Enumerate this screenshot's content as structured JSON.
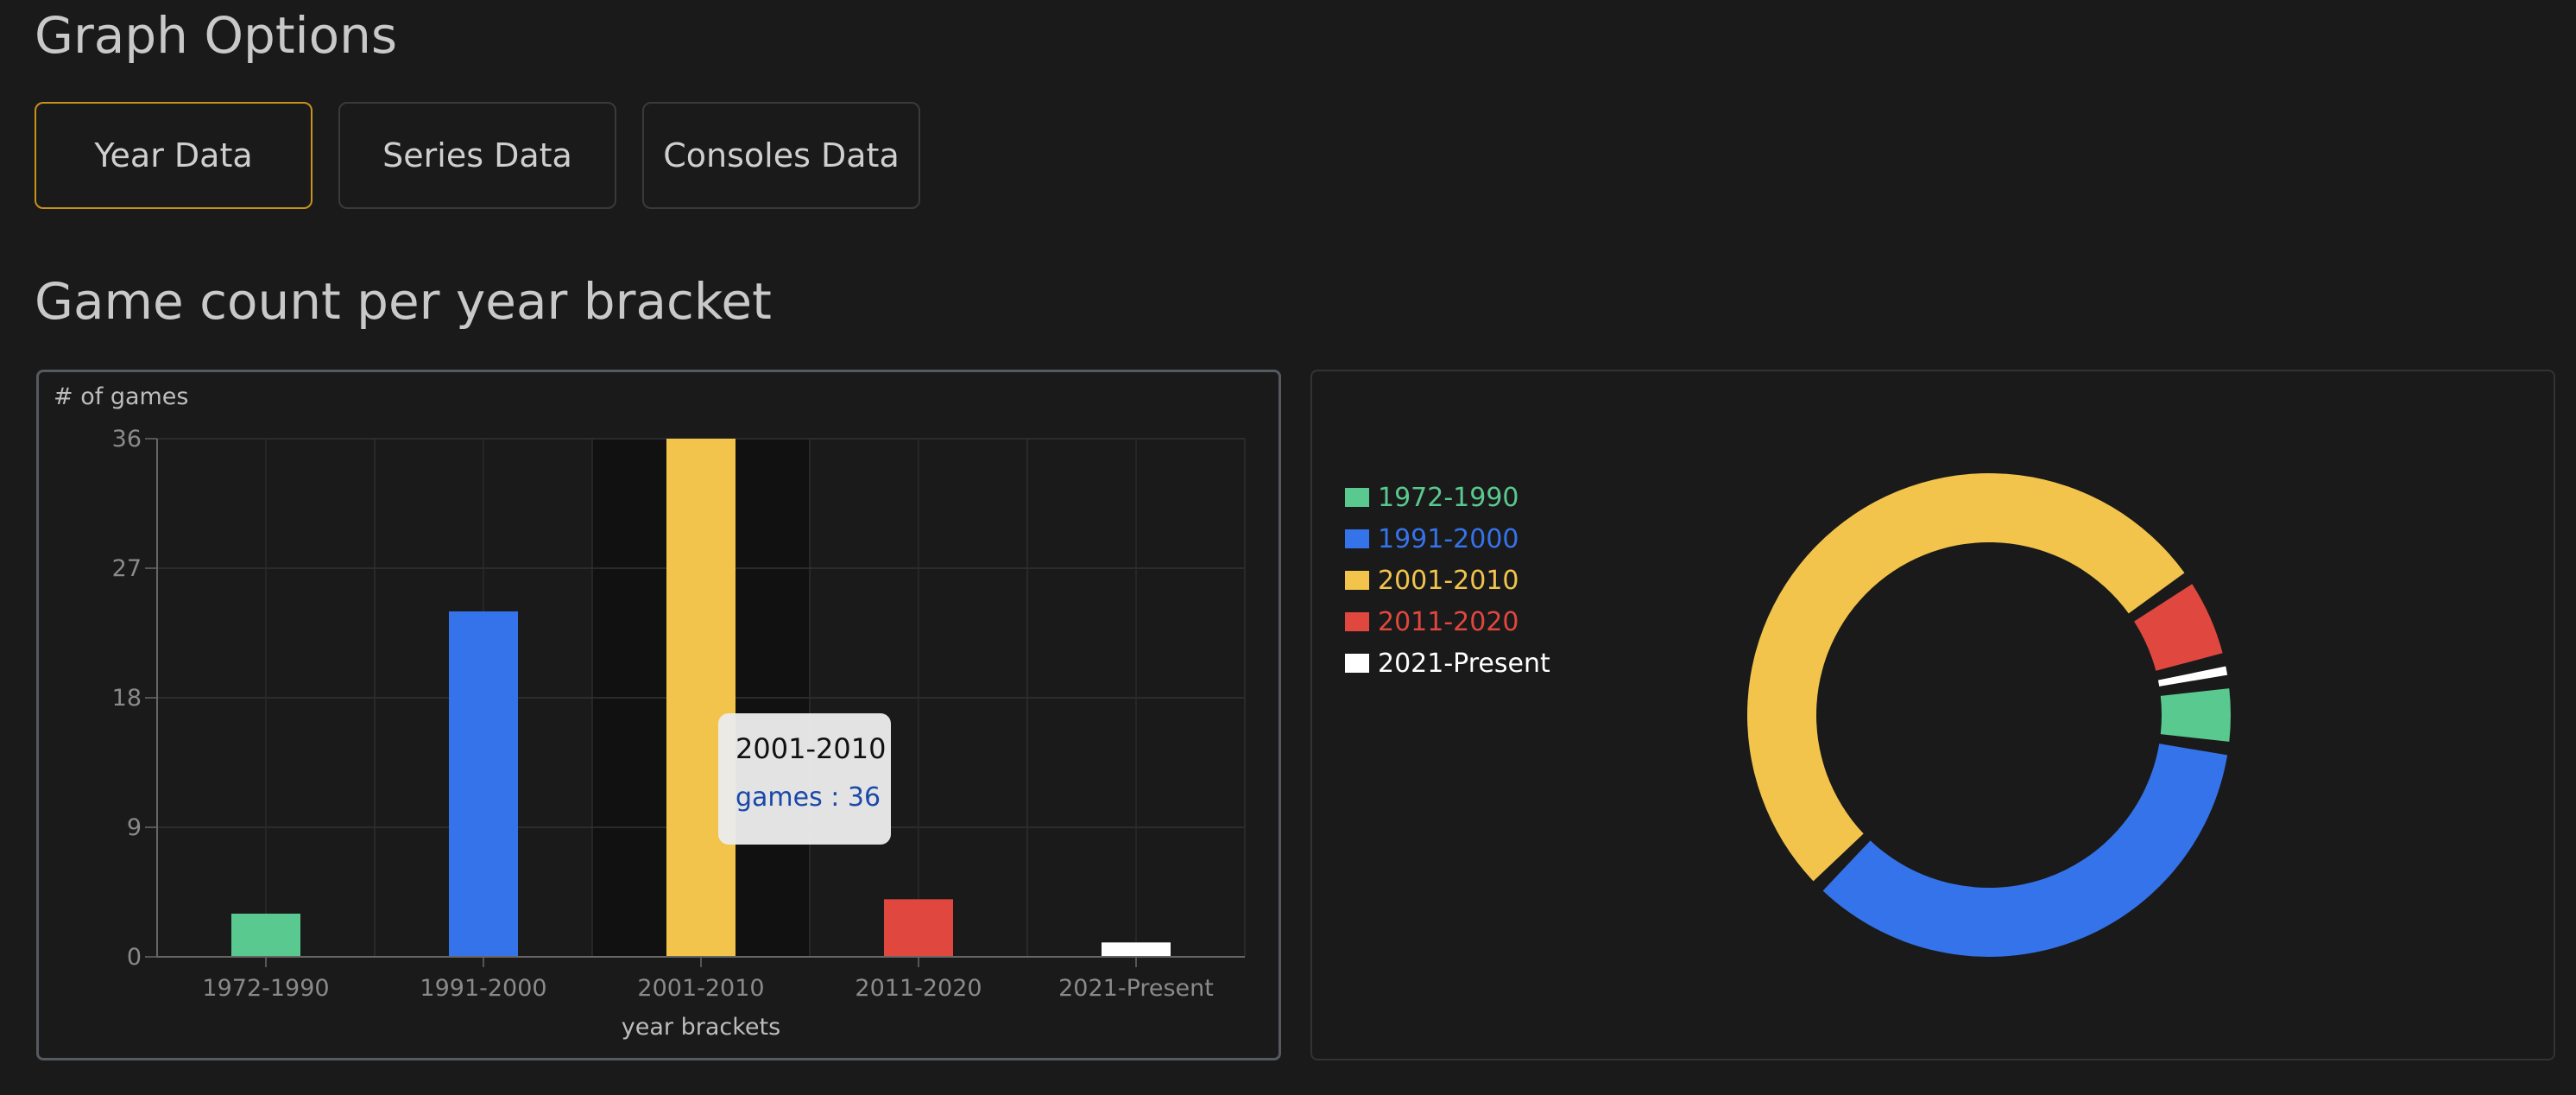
{
  "page": {
    "options_title": "Graph Options",
    "chart_section_title": "Game count per year bracket"
  },
  "tabs": [
    {
      "label": "Year Data",
      "active": true
    },
    {
      "label": "Series Data",
      "active": false
    },
    {
      "label": "Consoles Data",
      "active": false
    }
  ],
  "tooltip": {
    "title": "2001-2010",
    "value_text": "games : 36"
  },
  "colors": {
    "1972-1990": "#5ac98f",
    "1991-2000": "#3573ea",
    "2001-2010": "#f2c44c",
    "2011-2020": "#e0473f",
    "2021-Present": "#ffffff"
  },
  "chart_data": [
    {
      "type": "bar",
      "categories": [
        "1972-1990",
        "1991-2000",
        "2001-2010",
        "2011-2020",
        "2021-Present"
      ],
      "values": [
        3,
        24,
        36,
        4,
        1
      ],
      "ylabel": "# of games",
      "xlabel": "year brackets",
      "ylim": [
        0,
        36
      ],
      "yticks": [
        0,
        9,
        18,
        27,
        36
      ],
      "grid": true
    },
    {
      "type": "pie",
      "variant": "donut",
      "labels": [
        "1972-1990",
        "1991-2000",
        "2001-2010",
        "2011-2020",
        "2021-Present"
      ],
      "values": [
        3,
        24,
        36,
        4,
        1
      ],
      "legend": "top-left"
    }
  ]
}
